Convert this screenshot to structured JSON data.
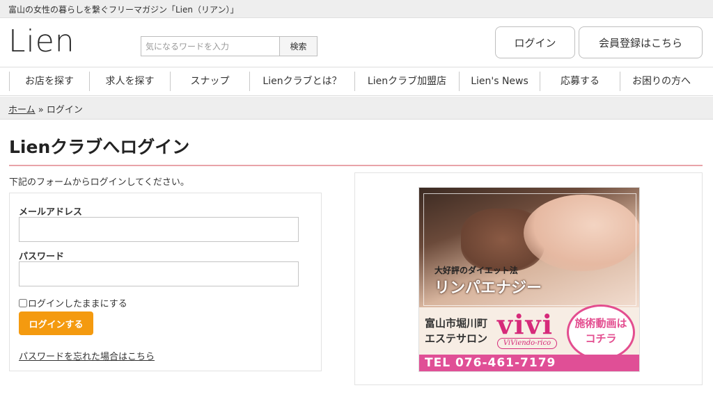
{
  "header": {
    "tagline": "富山の女性の暮らしを繋ぐフリーマガジン「Lien（リアン）」",
    "logo": "Lien",
    "search": {
      "placeholder": "気になるワードを入力",
      "button": "検索"
    },
    "login_button": "ログイン",
    "register_button": "会員登録はこちら"
  },
  "nav": {
    "items": [
      "お店を探す",
      "求人を探す",
      "スナップ",
      "Lienクラブとは？",
      "Lienクラブ加盟店",
      "Lien's News",
      "応募する",
      "お困りの方へ"
    ]
  },
  "breadcrumb": {
    "home": "ホーム",
    "separator": "»",
    "current": "ログイン"
  },
  "page": {
    "title": "Lienクラブへログイン",
    "intro": "下記のフォームからログインしてください。"
  },
  "form": {
    "email_label": "メールアドレス",
    "email_value": "",
    "password_label": "パスワード",
    "password_value": "",
    "remember_label": "ログインしたままにする",
    "remember_checked": false,
    "submit": "ログインする",
    "forgot_link": "パスワードを忘れた場合はこちら"
  },
  "ad": {
    "sub": "大好評のダイエット法",
    "main": "リンパエナジー",
    "place_line1": "富山市堀川町",
    "place_line2": "エステサロン",
    "brand": "vivi",
    "brand_sub": "ViViendo-rico",
    "cta_line1": "施術動画は",
    "cta_line2": "コチラ",
    "tel": "TEL 076-461-7179"
  },
  "colors": {
    "accent_orange": "#f49a0f",
    "title_rule_pink": "#e8a3a8",
    "ad_pink": "#e04f96"
  }
}
